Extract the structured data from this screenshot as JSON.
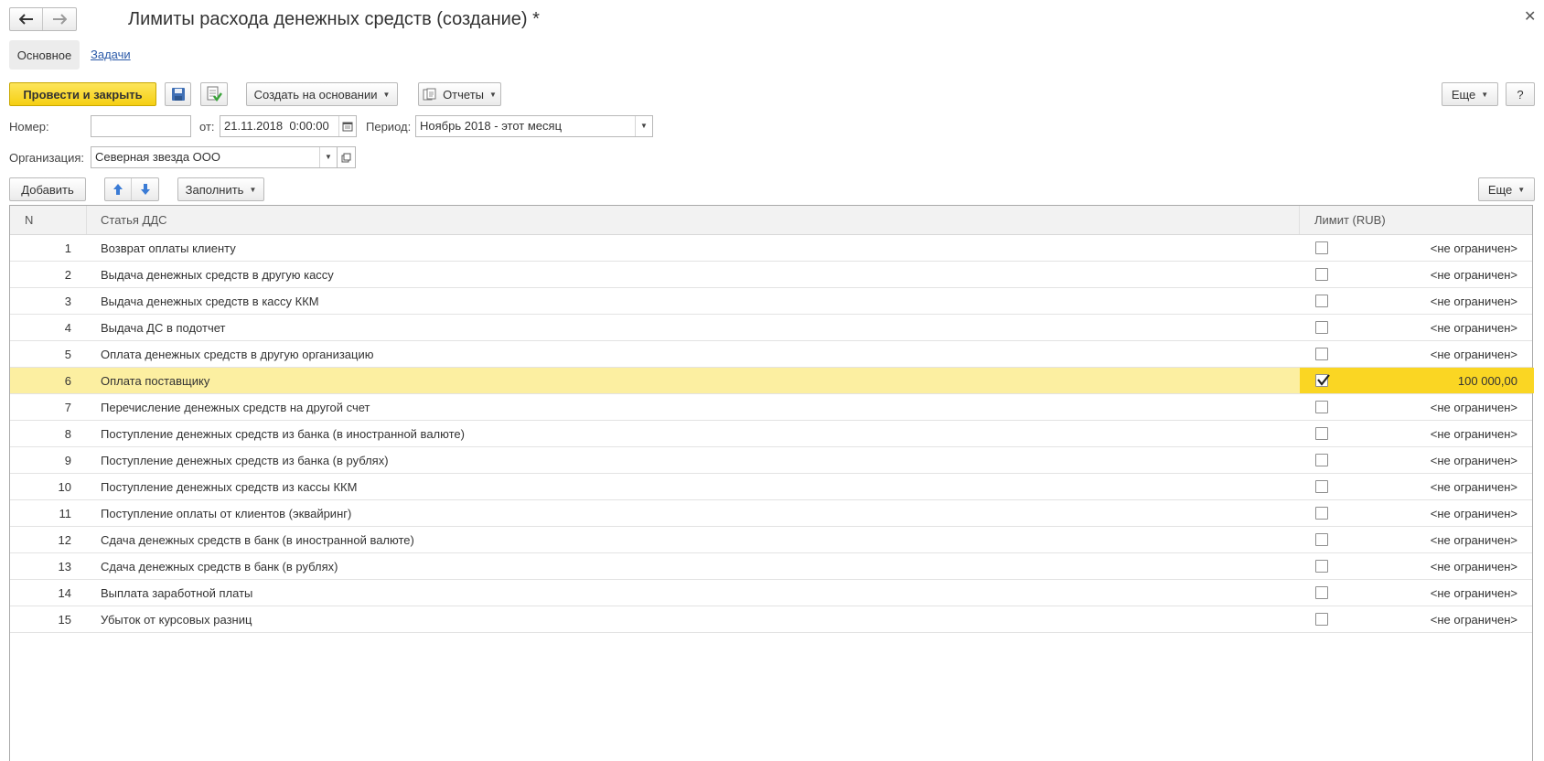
{
  "window": {
    "title": "Лимиты расхода денежных средств (создание) *"
  },
  "nav_tabs": [
    {
      "label": "Основное",
      "active": true
    },
    {
      "label": "Задачи",
      "active": false
    }
  ],
  "toolbar": {
    "post_close_label": "Провести и закрыть",
    "create_based_label": "Создать на основании",
    "reports_label": "Отчеты",
    "more_label": "Еще",
    "help_label": "?"
  },
  "form": {
    "number_label": "Номер:",
    "number_value": "",
    "date_label": "от:",
    "date_value": "21.11.2018  0:00:00",
    "period_label": "Период:",
    "period_value": "Ноябрь 2018 - этот месяц",
    "org_label": "Организация:",
    "org_value": "Северная звезда ООО"
  },
  "table_toolbar": {
    "add_label": "Добавить",
    "fill_label": "Заполнить",
    "more_label": "Еще"
  },
  "table": {
    "columns": [
      "N",
      "Статья ДДС",
      "Лимит (RUB)"
    ],
    "rows": [
      {
        "n": "1",
        "name": "Возврат оплаты клиенту",
        "checked": false,
        "limit": "<не ограничен>"
      },
      {
        "n": "2",
        "name": "Выдача денежных средств в другую кассу",
        "checked": false,
        "limit": "<не ограничен>"
      },
      {
        "n": "3",
        "name": "Выдача денежных средств в кассу ККМ",
        "checked": false,
        "limit": "<не ограничен>"
      },
      {
        "n": "4",
        "name": "Выдача ДС в подотчет",
        "checked": false,
        "limit": "<не ограничен>"
      },
      {
        "n": "5",
        "name": "Оплата денежных средств в другую организацию",
        "checked": false,
        "limit": "<не ограничен>"
      },
      {
        "n": "6",
        "name": "Оплата поставщику",
        "checked": true,
        "limit": "100 000,00",
        "selected": true
      },
      {
        "n": "7",
        "name": "Перечисление денежных средств на другой счет",
        "checked": false,
        "limit": "<не ограничен>"
      },
      {
        "n": "8",
        "name": "Поступление денежных средств из банка (в иностранной валюте)",
        "checked": false,
        "limit": "<не ограничен>"
      },
      {
        "n": "9",
        "name": "Поступление денежных средств из банка (в рублях)",
        "checked": false,
        "limit": "<не ограничен>"
      },
      {
        "n": "10",
        "name": "Поступление денежных средств из кассы ККМ",
        "checked": false,
        "limit": "<не ограничен>"
      },
      {
        "n": "11",
        "name": "Поступление оплаты от клиентов (эквайринг)",
        "checked": false,
        "limit": "<не ограничен>"
      },
      {
        "n": "12",
        "name": "Сдача денежных средств в банк (в иностранной валюте)",
        "checked": false,
        "limit": "<не ограничен>"
      },
      {
        "n": "13",
        "name": "Сдача денежных средств в банк (в рублях)",
        "checked": false,
        "limit": "<не ограничен>"
      },
      {
        "n": "14",
        "name": "Выплата заработной платы",
        "checked": false,
        "limit": "<не ограничен>"
      },
      {
        "n": "15",
        "name": "Убыток от курсовых разниц",
        "checked": false,
        "limit": "<не ограничен>"
      }
    ]
  },
  "colors": {
    "primary_button": "#f5cf12",
    "selected_row": "#fcefa1",
    "selected_limit_cell": "#fad623",
    "link": "#2b5aa8",
    "arrow_blue": "#3a7bd5"
  }
}
